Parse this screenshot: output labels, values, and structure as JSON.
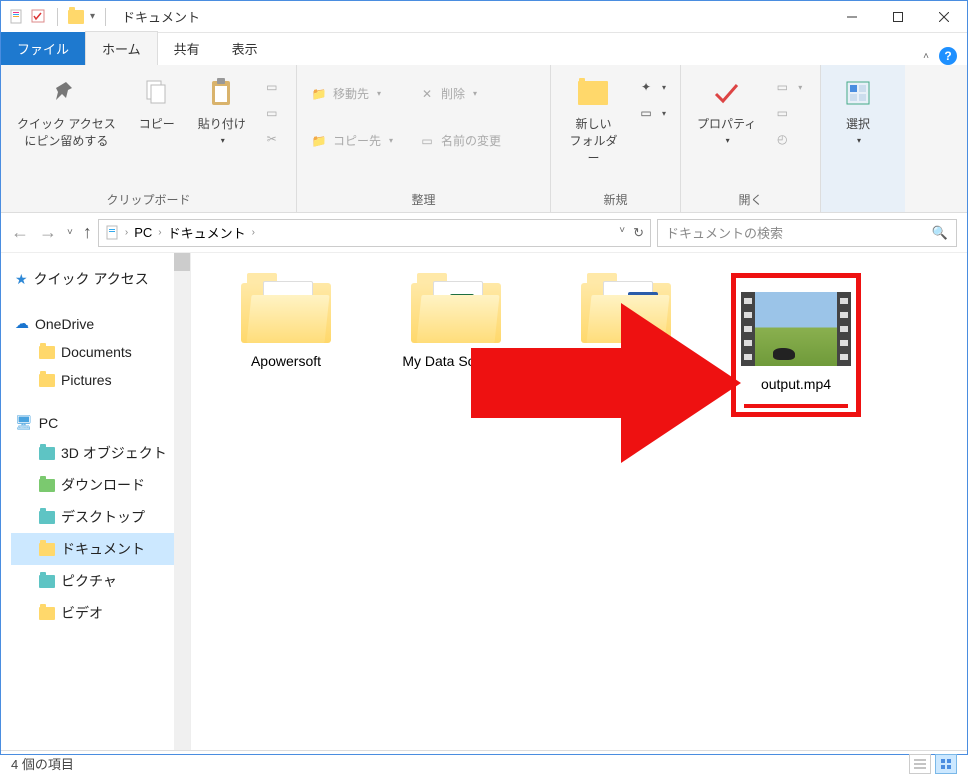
{
  "window": {
    "title": "ドキュメント"
  },
  "tabs": {
    "file": "ファイル",
    "home": "ホーム",
    "share": "共有",
    "view": "表示"
  },
  "ribbon": {
    "clipboard": {
      "pin": "クイック アクセス\nにピン留めする",
      "copy": "コピー",
      "paste": "貼り付け",
      "label": "クリップボード"
    },
    "organize": {
      "moveTo": "移動先",
      "copyTo": "コピー先",
      "delete": "削除",
      "rename": "名前の変更",
      "label": "整理"
    },
    "new": {
      "folder": "新しい\nフォルダー",
      "label": "新規"
    },
    "open": {
      "properties": "プロパティ",
      "label": "開く"
    },
    "select": {
      "select": "選択",
      "label": ""
    }
  },
  "breadcrumb": {
    "root": "PC",
    "current": "ドキュメント"
  },
  "search": {
    "placeholder": "ドキュメントの検索"
  },
  "sidebar": {
    "quickAccess": "クイック アクセス",
    "oneDrive": "OneDrive",
    "documents": "Documents",
    "pictures": "Pictures",
    "pc": "PC",
    "threeDObjects": "3D オブジェクト",
    "downloads": "ダウンロード",
    "desktop": "デスクトップ",
    "documentsJp": "ドキュメント",
    "picturesJp": "ピクチャ",
    "videosJp": "ビデオ"
  },
  "items": [
    {
      "name": "Apowersoft",
      "type": "folder"
    },
    {
      "name": "My Data Sources",
      "type": "folder-excel"
    },
    {
      "name": "",
      "type": "folder-blue"
    },
    {
      "name": "output.mp4",
      "type": "video"
    }
  ],
  "status": {
    "count": "4 個の項目"
  }
}
